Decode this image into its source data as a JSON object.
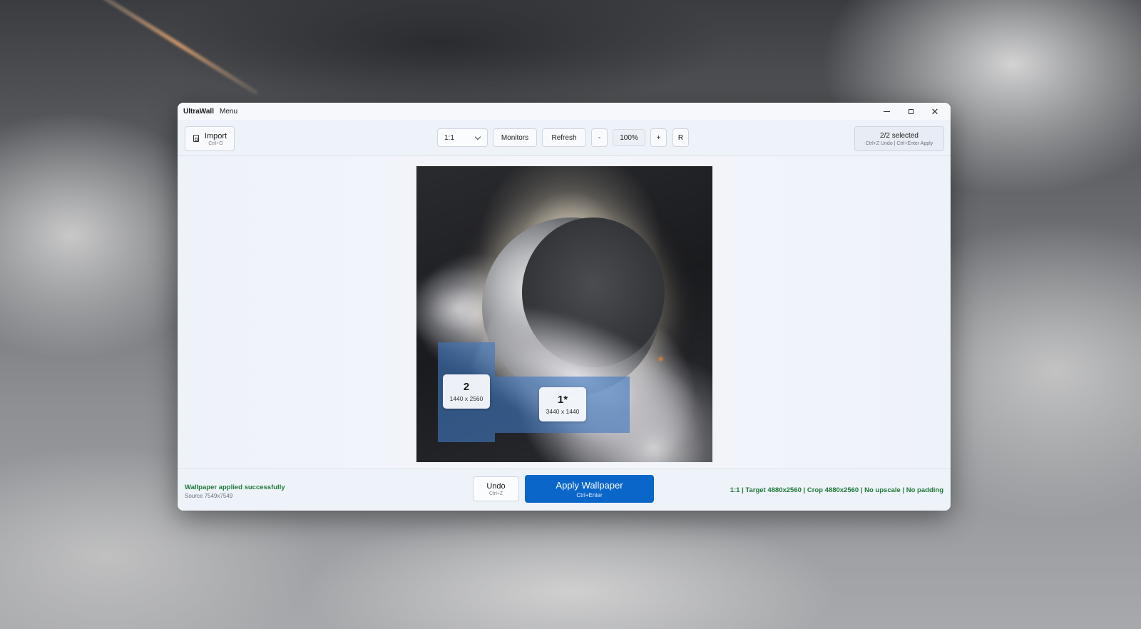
{
  "window": {
    "app_name": "UltraWall",
    "menu_label": "Menu"
  },
  "toolbar": {
    "import_label": "Import",
    "import_shortcut": "Ctrl+O",
    "ratio_value": "1:1",
    "monitors_label": "Monitors",
    "refresh_label": "Refresh",
    "zoom_out_label": "-",
    "zoom_level": "100%",
    "zoom_in_label": "+",
    "reset_label": "R",
    "selection_title": "2/2 selected",
    "selection_hint": "Ctrl+Z Undo  |  Ctrl+Enter Apply"
  },
  "monitors": [
    {
      "id": "2",
      "resolution": "1440 x 2560"
    },
    {
      "id": "1*",
      "resolution": "3440 x 1440"
    }
  ],
  "footer": {
    "status_title": "Wallpaper applied successfully",
    "status_sub": "Source 7549x7549",
    "undo_label": "Undo",
    "undo_shortcut": "Ctrl+Z",
    "apply_label": "Apply Wallpaper",
    "apply_shortcut": "Ctrl+Enter",
    "summary": "1:1 | Target 4880x2560 | Crop 4880x2560 | No upscale | No padding"
  },
  "colors": {
    "accent": "#0a66c9",
    "success": "#1f7a3a",
    "monitor_overlay": "#3f78be"
  },
  "icons": [
    "import-icon",
    "chevron-down-icon",
    "minimize-icon",
    "maximize-icon",
    "close-icon"
  ]
}
